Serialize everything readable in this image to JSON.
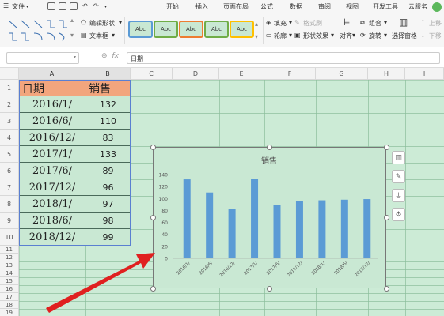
{
  "menubar": {
    "file_label": "文件",
    "tabs": [
      "开始",
      "插入",
      "页面布局",
      "公式",
      "数据",
      "审阅",
      "视图",
      "开发工具",
      "云服务"
    ]
  },
  "ribbon": {
    "edit_shape_label": "编辑形状",
    "textbox_label": "文本框",
    "style_label": "Abc",
    "fill_label": "填充",
    "format_brush_label": "格式刷",
    "outline_label": "轮廓",
    "shape_effect_label": "形状效果",
    "align_label": "对齐",
    "group_label": "组合",
    "rotate_label": "旋转",
    "selection_pane_label": "选择窗格",
    "bring_up_label": "上移",
    "send_down_label": "下移",
    "style_colors": [
      "#5b9bd5",
      "#ed7d31",
      "#a5a5a5",
      "#ffc000",
      "#4472c4",
      "#70ad47"
    ]
  },
  "formula_bar": {
    "fx_label": "fx",
    "content": "日期"
  },
  "sheet": {
    "columns": [
      "A",
      "B",
      "C",
      "D",
      "E",
      "F",
      "G",
      "H",
      "I"
    ],
    "rows": [
      "1",
      "2",
      "3",
      "4",
      "5",
      "6",
      "7",
      "8",
      "9",
      "10",
      "11",
      "12",
      "13",
      "14",
      "15",
      "16",
      "17",
      "18",
      "19"
    ],
    "header": {
      "date": "日期",
      "sales": "销售"
    },
    "data": [
      {
        "date": "2016/1/",
        "sales": "132"
      },
      {
        "date": "2016/6/",
        "sales": "110"
      },
      {
        "date": "2016/12/",
        "sales": "83"
      },
      {
        "date": "2017/1/",
        "sales": "133"
      },
      {
        "date": "2017/6/",
        "sales": "89"
      },
      {
        "date": "2017/12/",
        "sales": "96"
      },
      {
        "date": "2018/1/",
        "sales": "97"
      },
      {
        "date": "2018/6/",
        "sales": "98"
      },
      {
        "date": "2018/12/",
        "sales": "99"
      }
    ],
    "header_fill": "#f2a57d",
    "grid_fill": "#ccebd6"
  },
  "chart_data": {
    "type": "bar",
    "title": "销售",
    "categories": [
      "2016/1/",
      "2016/6/",
      "2016/12/",
      "2017/1/",
      "2017/6/",
      "2017/12/",
      "2018/1/",
      "2018/6/",
      "2018/12/"
    ],
    "values": [
      132,
      110,
      83,
      133,
      89,
      96,
      97,
      98,
      99
    ],
    "ylim": [
      0,
      140
    ],
    "yticks": [
      "0",
      "20",
      "40",
      "60",
      "80",
      "100",
      "120",
      "140"
    ],
    "bar_color": "#5b9bd5",
    "grid": false,
    "legend": "none"
  },
  "chart_tools": {
    "icons": [
      "chart-elements-icon",
      "chart-style-icon",
      "chart-filter-icon",
      "chart-settings-icon"
    ]
  },
  "annotation": {
    "arrow_color": "#e02020"
  }
}
